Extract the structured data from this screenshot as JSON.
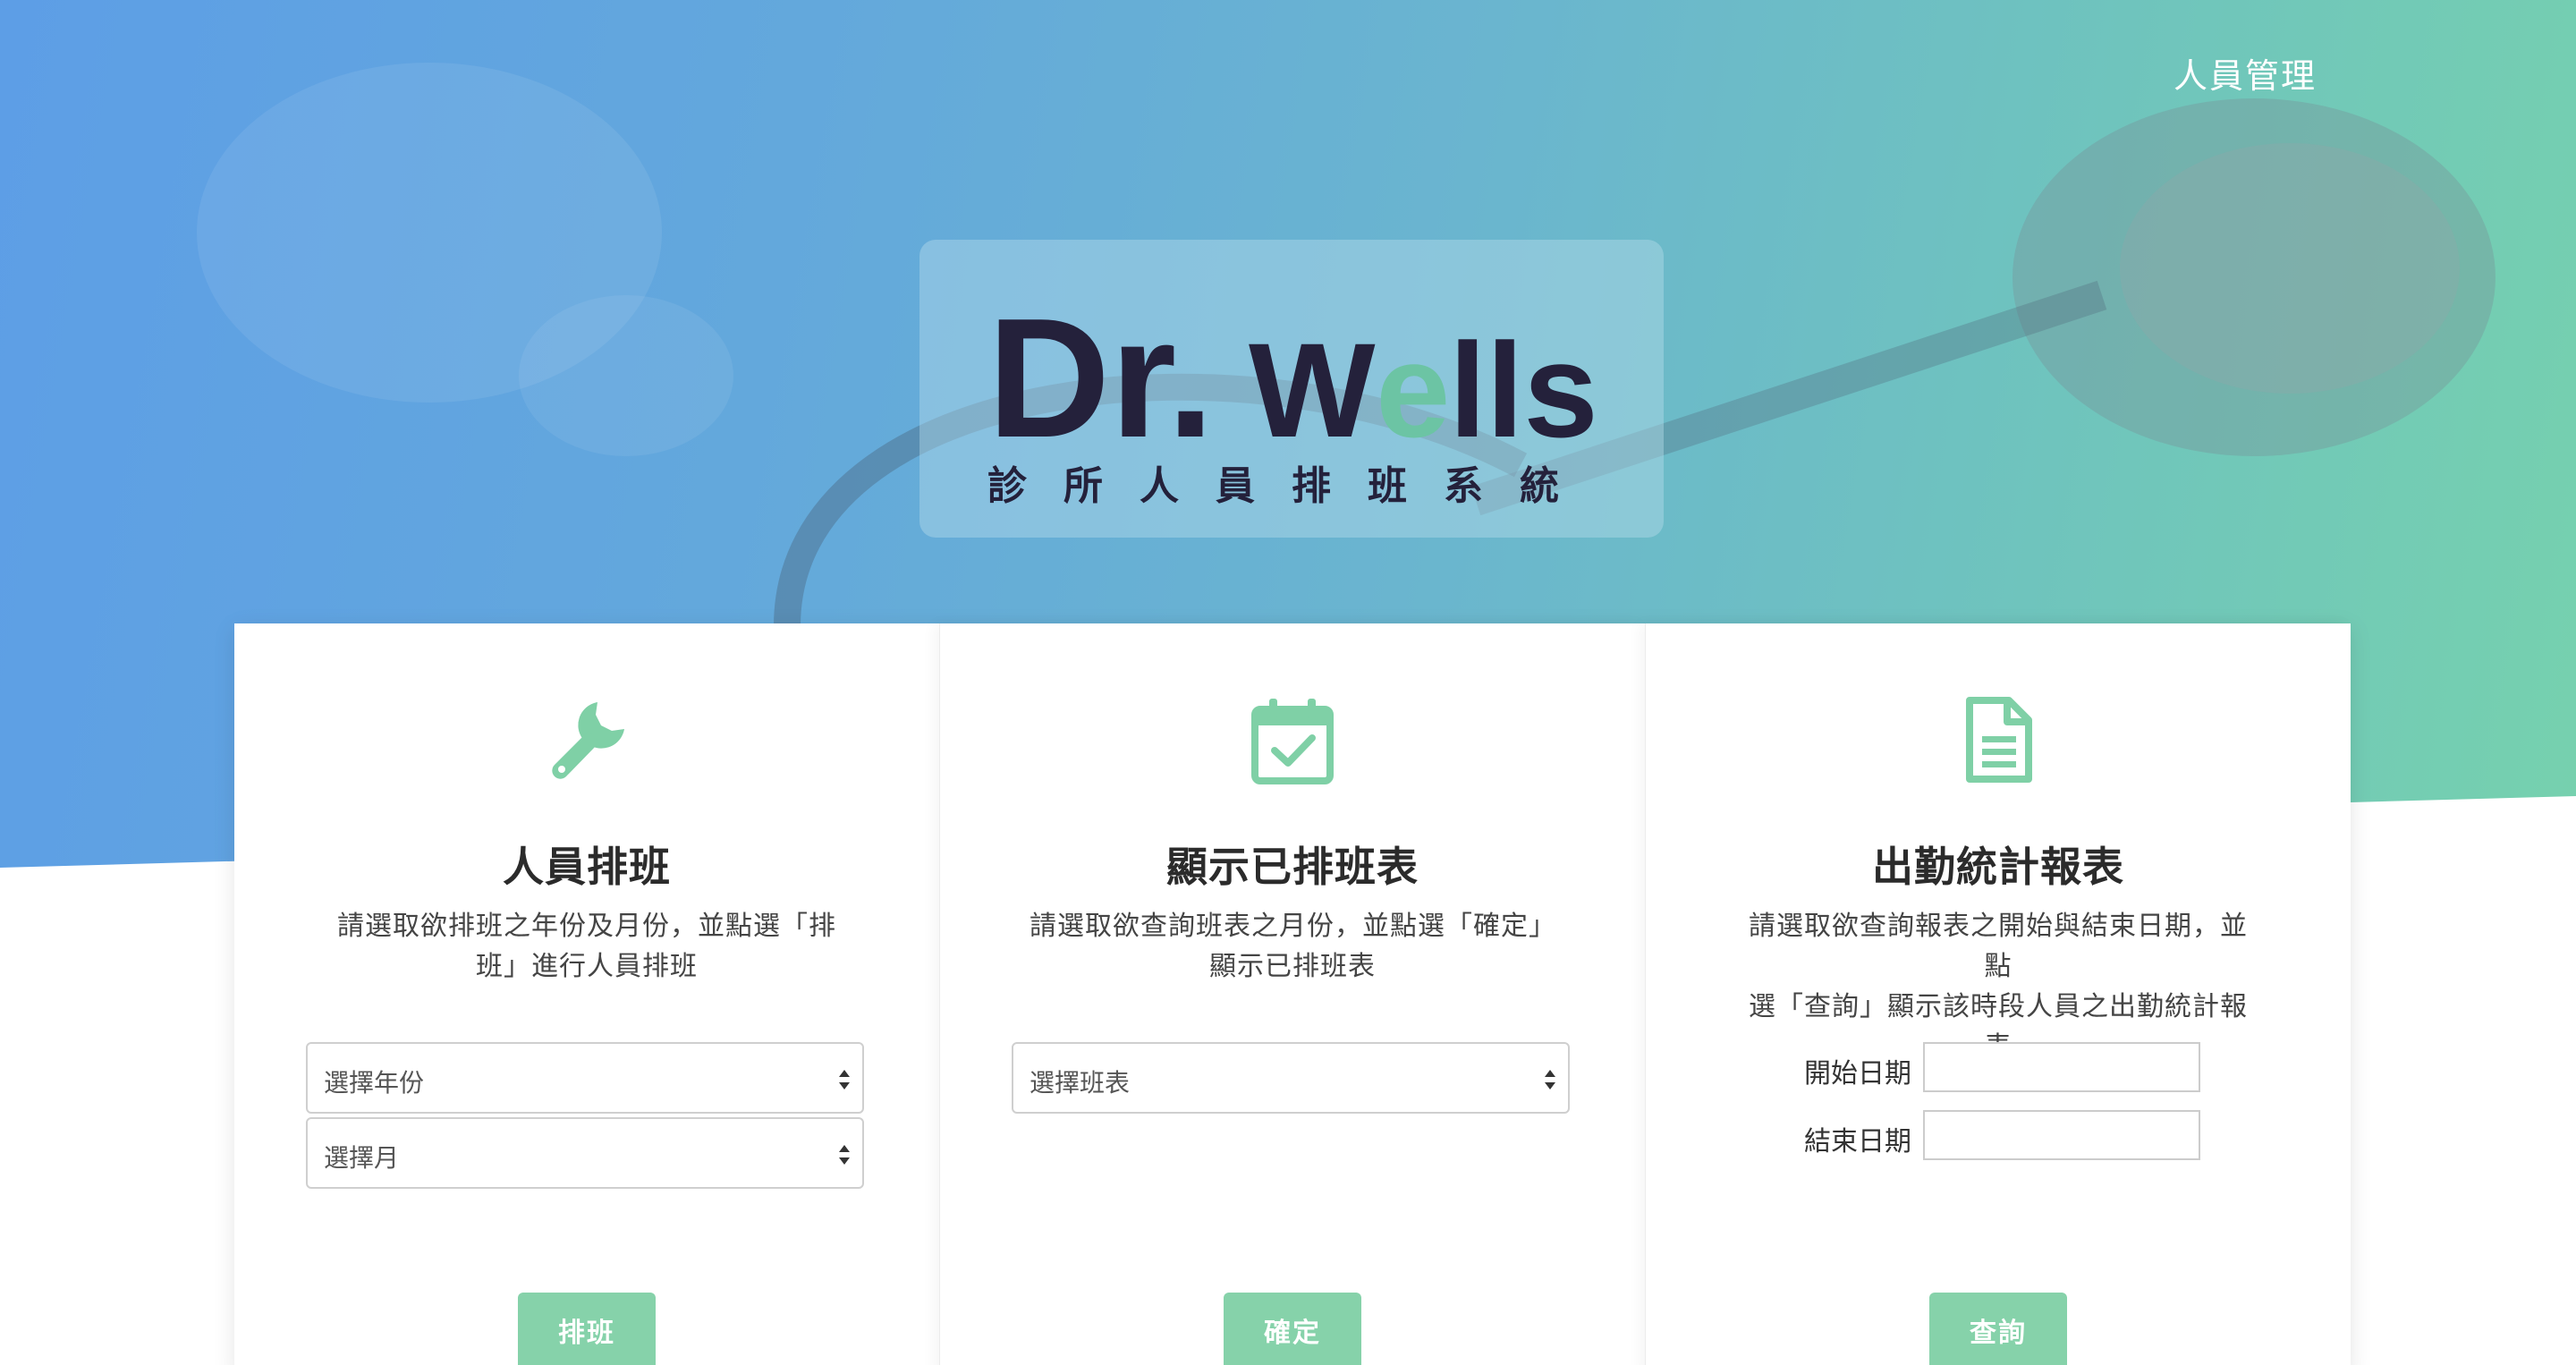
{
  "nav": {
    "staff_management": "人員管理"
  },
  "logo": {
    "brand_main": "Dr.",
    "brand_w": "W",
    "brand_e": "e",
    "brand_lls": "lls",
    "subtitle": "診所人員排班系統"
  },
  "colors": {
    "accent_green": "#86d2aa",
    "icon_green": "#7fd0a6",
    "logo_navy": "#24213b"
  },
  "cards": {
    "schedule": {
      "icon": "wrench-icon",
      "title": "人員排班",
      "desc_line1": "請選取欲排班之年份及月份，並點選「排",
      "desc_line2": "班」進行人員排班",
      "year_select": "選擇年份",
      "month_select": "選擇月",
      "button": "排班"
    },
    "view": {
      "icon": "calendar-check-icon",
      "title": "顯示已排班表",
      "desc_line1": "請選取欲查詢班表之月份，並點選「確定」",
      "desc_line2": "顯示已排班表",
      "table_select": "選擇班表",
      "button": "確定"
    },
    "report": {
      "icon": "document-icon",
      "title": "出勤統計報表",
      "desc_line1": "請選取欲查詢報表之開始與結束日期，並點",
      "desc_line2": "選「查詢」顯示該時段人員之出勤統計報表",
      "start_label": "開始日期",
      "end_label": "結束日期",
      "start_value": "",
      "end_value": "",
      "button": "查詢"
    }
  }
}
